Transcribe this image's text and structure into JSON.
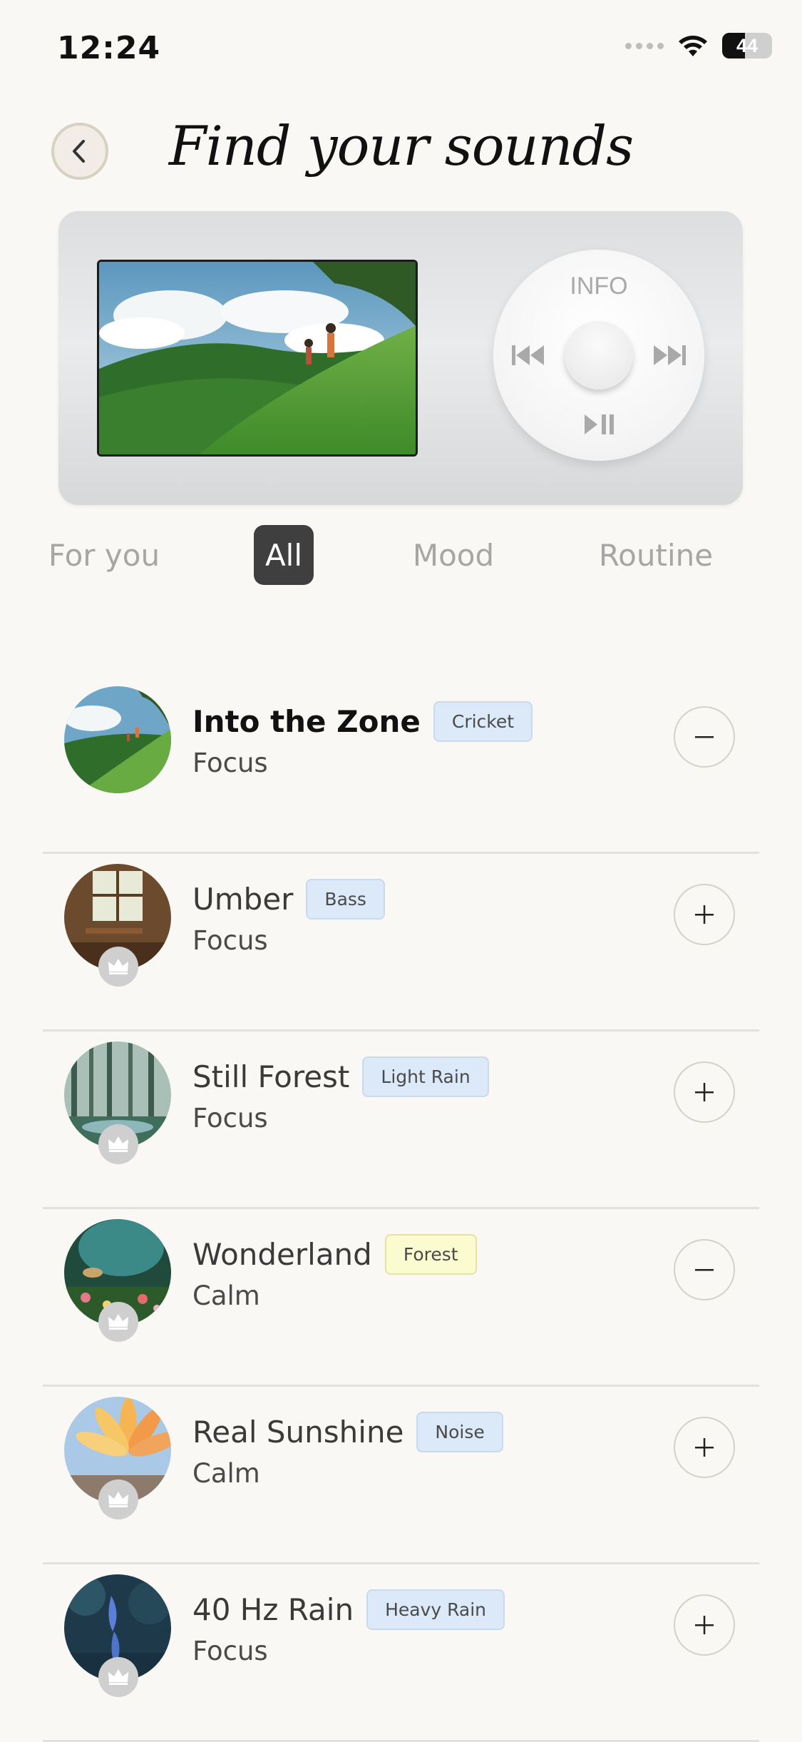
{
  "status_bar": {
    "time": "12:24",
    "battery": "44"
  },
  "header": {
    "title": "Find your sounds"
  },
  "player": {
    "wheel_label": "INFO"
  },
  "tabs": [
    {
      "label": "For you",
      "active": false
    },
    {
      "label": "All",
      "active": true
    },
    {
      "label": "Mood",
      "active": false
    },
    {
      "label": "Routine",
      "active": false
    }
  ],
  "sounds": [
    {
      "name": "Into the Zone",
      "tag": "Cricket",
      "tag_color": "blue",
      "category": "Focus",
      "action": "remove",
      "premium": false,
      "playing": true
    },
    {
      "name": "Umber",
      "tag": "Bass",
      "tag_color": "blue",
      "category": "Focus",
      "action": "add",
      "premium": true,
      "playing": false
    },
    {
      "name": "Still Forest",
      "tag": "Light Rain",
      "tag_color": "blue",
      "category": "Focus",
      "action": "add",
      "premium": true,
      "playing": false
    },
    {
      "name": "Wonderland",
      "tag": "Forest",
      "tag_color": "yellow",
      "category": "Calm",
      "action": "remove",
      "premium": true,
      "playing": false
    },
    {
      "name": "Real Sunshine",
      "tag": "Noise",
      "tag_color": "blue",
      "category": "Calm",
      "action": "add",
      "premium": true,
      "playing": false
    },
    {
      "name": "40 Hz Rain",
      "tag": "Heavy Rain",
      "tag_color": "blue",
      "category": "Focus",
      "action": "add",
      "premium": true,
      "playing": false
    }
  ],
  "colors": {
    "accent": "#3f3f3f",
    "background": "#faf8f5",
    "badge_blue": "#dce9f8",
    "badge_yellow": "#fafbcf"
  }
}
